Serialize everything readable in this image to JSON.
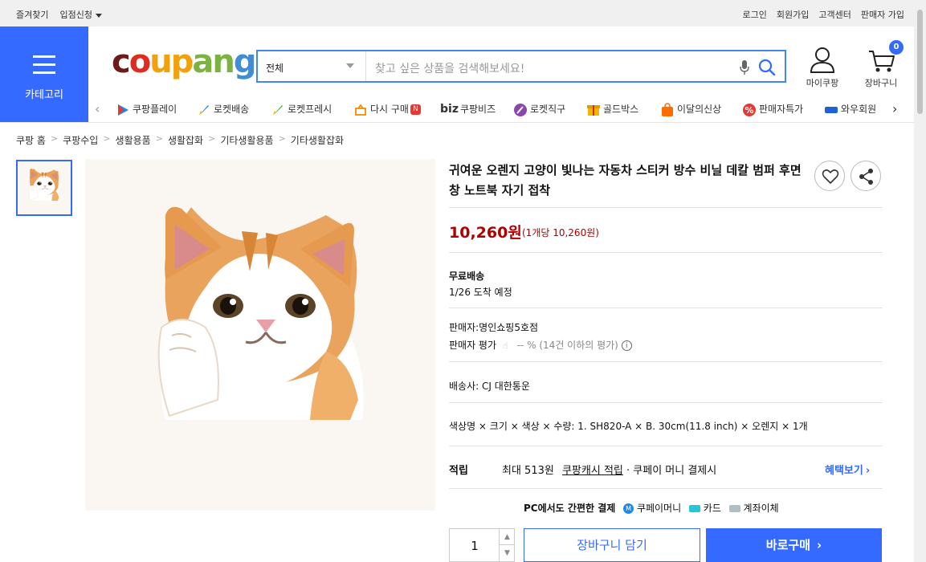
{
  "topbar": {
    "favorites": "즐겨찾기",
    "store_apply": "입점신청",
    "login": "로그인",
    "signup": "회원가입",
    "customer_center": "고객센터",
    "seller_signup": "판매자 가입"
  },
  "header": {
    "category_label": "카테고리",
    "logo_parts": [
      "c",
      "o",
      "u",
      "p",
      "a",
      "n",
      "g"
    ],
    "search": {
      "category_value": "전체",
      "placeholder": "찾고 싶은 상품을 검색해보세요!"
    },
    "mycoupang_label": "마이쿠팡",
    "cart_label": "장바구니",
    "cart_count": "0"
  },
  "shortcuts": [
    {
      "label": "쿠팡플레이",
      "icon": "play-icon",
      "color": "#1e88e5"
    },
    {
      "label": "로켓배송",
      "icon": "rocket-icon",
      "color": "#2a7de1"
    },
    {
      "label": "로켓프레시",
      "icon": "fresh-rocket-icon",
      "color": "#3cb043"
    },
    {
      "label": "다시 구매",
      "icon": "basket-icon",
      "color": "#f08c00",
      "badge": "N"
    },
    {
      "label": "쿠팡비즈",
      "icon": "biz-icon",
      "prefix": "biz",
      "color": "#333333"
    },
    {
      "label": "로켓직구",
      "icon": "global-rocket-icon",
      "color": "#8e44ad"
    },
    {
      "label": "골드박스",
      "icon": "goldbox-icon",
      "color": "#f4b400"
    },
    {
      "label": "이달의신상",
      "icon": "new-bag-icon",
      "color": "#ff6d00"
    },
    {
      "label": "판매자특가",
      "icon": "percent-icon",
      "color": "#e53935"
    },
    {
      "label": "와우회원",
      "icon": "wow-icon",
      "color": "#1e63d6"
    }
  ],
  "breadcrumb": [
    "쿠팡 홈",
    "쿠팡수입",
    "생활용품",
    "생활잡화",
    "기타생활용품",
    "기타생활잡화"
  ],
  "product": {
    "title": "귀여운 오렌지 고양이 빛나는 자동차 스티커 방수 비닐 데칼 범퍼 후면 창 노트북 자기 접착",
    "price": "10,260원",
    "unit_price": "(1개당 10,260원)",
    "shipping_label": "무료배송",
    "arrival": "1/26 도착 예정",
    "seller": "판매자:명인쇼핑5호점",
    "seller_rating_label": "판매자 평가",
    "seller_rating_value": "-- % (14건 이하의 평가)",
    "carrier": "배송사:  CJ 대한통운",
    "option": "색상명 × 크기 × 색상 × 수량: 1. SH820-A × B. 30cm(11.8 inch) × 오렌지 × 1개",
    "reward_label": "적립",
    "reward_text": "최대 513원",
    "reward_link": "쿠팡캐시 적립",
    "reward_suffix": "· 쿠페이 머니 결제시",
    "benefit_link": "혜택보기",
    "pay_label": "PC에서도 간편한 결제",
    "pay_money": "쿠페이머니",
    "pay_card": "카드",
    "pay_bank": "계좌이체",
    "quantity": "1",
    "add_to_cart": "장바구니 담기",
    "buy_now": "바로구매"
  }
}
